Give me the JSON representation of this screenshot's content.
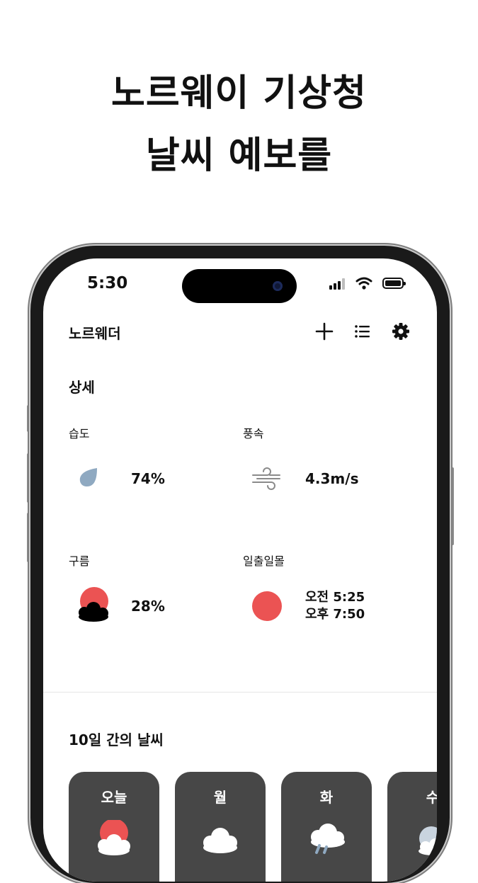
{
  "promo": {
    "line1": "노르웨이 기상청",
    "line2": "날씨 예보를"
  },
  "status_bar": {
    "time": "5:30"
  },
  "app": {
    "title": "노르웨더",
    "actions": [
      "add-icon",
      "list-icon",
      "gear-icon"
    ]
  },
  "details": {
    "title": "상세",
    "humidity": {
      "label": "습도",
      "value": "74%",
      "icon": "raindrop-icon"
    },
    "wind": {
      "label": "풍속",
      "value": "4.3m/s",
      "icon": "wind-icon"
    },
    "cloud": {
      "label": "구름",
      "value": "28%",
      "icon": "sun-cloud-icon"
    },
    "sun": {
      "label": "일출일몰",
      "sunrise": "오전 5:25",
      "sunset": "오후 7:50",
      "icon": "sun-icon"
    }
  },
  "forecast": {
    "title": "10일 간의 날씨",
    "days": [
      {
        "label": "오늘",
        "icon": "sun-cloud-icon"
      },
      {
        "label": "월",
        "icon": "cloud-icon"
      },
      {
        "label": "화",
        "icon": "rain-cloud-icon"
      },
      {
        "label": "수",
        "icon": "moon-cloud-icon"
      }
    ]
  },
  "colors": {
    "sun": "#eb5353",
    "drop": "#8fa9c1",
    "card_bg": "#474747"
  }
}
